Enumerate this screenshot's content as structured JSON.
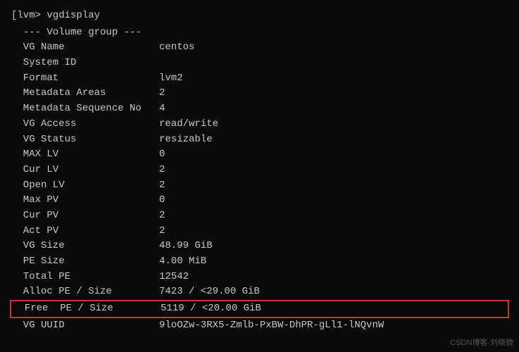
{
  "terminal": {
    "prompt_line": "[lvm> vgdisplay",
    "section_header": "  --- Volume group ---",
    "rows": [
      {
        "label": "  VG Name",
        "value": "centos"
      },
      {
        "label": "  System ID",
        "value": ""
      },
      {
        "label": "  Format",
        "value": "lvm2"
      },
      {
        "label": "  Metadata Areas",
        "value": "2"
      },
      {
        "label": "  Metadata Sequence No",
        "value": "4"
      },
      {
        "label": "  VG Access",
        "value": "read/write"
      },
      {
        "label": "  VG Status",
        "value": "resizable"
      },
      {
        "label": "  MAX LV",
        "value": "0"
      },
      {
        "label": "  Cur LV",
        "value": "2"
      },
      {
        "label": "  Open LV",
        "value": "2"
      },
      {
        "label": "  Max PV",
        "value": "0"
      },
      {
        "label": "  Cur PV",
        "value": "2"
      },
      {
        "label": "  Act PV",
        "value": "2"
      },
      {
        "label": "  VG Size",
        "value": "48.99 GiB"
      },
      {
        "label": "  PE Size",
        "value": "4.00 MiB"
      },
      {
        "label": "  Total PE",
        "value": "12542"
      },
      {
        "label": "  Alloc PE / Size",
        "value": "7423 / <29.00 GiB"
      },
      {
        "label": "  Free  PE / Size",
        "value": "5119 / <20.00 GiB",
        "highlighted": true
      },
      {
        "label": "  VG UUID",
        "value": "9loOZw-3RX5-Zmlb-PxBW-DhPR-gLl1-lNQvnW"
      }
    ]
  },
  "watermark": "CSDN博客·刘晓微"
}
